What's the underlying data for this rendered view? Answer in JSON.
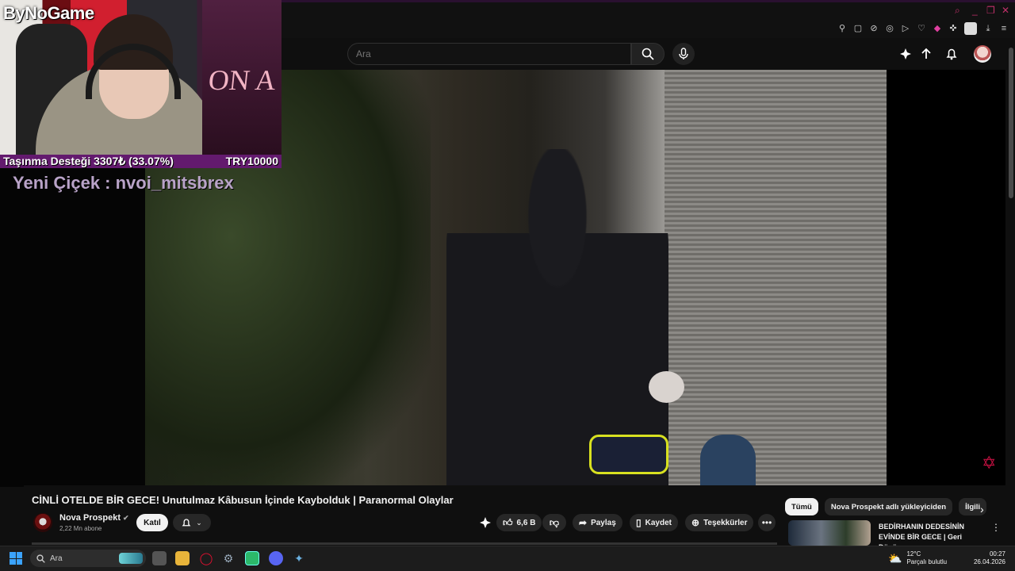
{
  "search": {
    "placeholder": "Ara"
  },
  "overlay": {
    "brand": "ByNoGame",
    "poster_text": "ON A",
    "donation_label": "Taşınma Desteği 3307₺ (33.07%)",
    "donation_goal": "TRY10000",
    "new_flower": "Yeni Çiçek : nvoi_mitsbrex"
  },
  "video": {
    "title": "CİNLİ OTELDE BİR GECE! Unutulmaz Kâbusun İçinde Kaybolduk | Paranormal Olaylar",
    "channel_name": "Nova Prospekt",
    "subscribers": "2,22 Mn abone",
    "join_label": "Katıl",
    "likes": "6,6 B",
    "share_label": "Paylaş",
    "save_label": "Kaydet",
    "thanks_label": "Teşekkürler",
    "more_label": "•••"
  },
  "sidebar": {
    "chips": [
      "Tümü",
      "Nova Prospekt adlı yükleyiciden",
      "İlgili"
    ],
    "recommended": {
      "title": "BEDİRHANIN DEDESİNİN EVİNDE BİR GECE | Geri Dönüş..."
    }
  },
  "taskbar": {
    "search_label": "Ara",
    "weather_temp": "12°C",
    "weather_desc": "Parçalı bulutlu",
    "time": "00:27",
    "date": "26.04.2026"
  },
  "colors": {
    "accent": "#631a6e",
    "youtube_bg": "#0f0f0f",
    "overlay_text": "#b9a3c8"
  }
}
